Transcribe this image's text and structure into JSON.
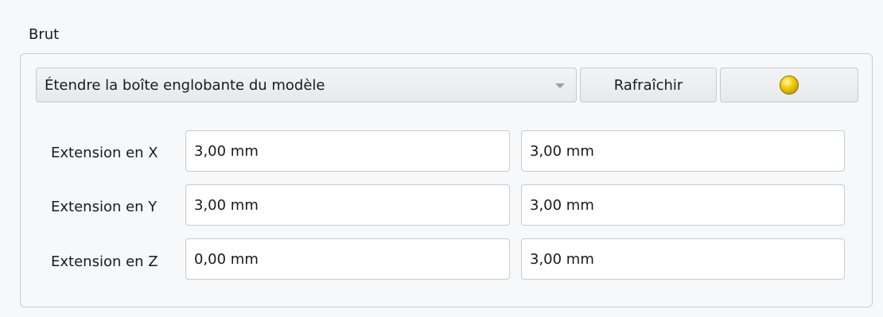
{
  "group": {
    "title": "Brut"
  },
  "toolbar": {
    "mode_selected": "Étendre la boîte englobante du modèle",
    "refresh_label": "Rafraîchir",
    "status_icon": "yellow-status-light-icon",
    "status_color": "#f4d20f"
  },
  "extensions": [
    {
      "label": "Extension en X",
      "min": "3,00 mm",
      "max": "3,00 mm"
    },
    {
      "label": "Extension en Y",
      "min": "3,00 mm",
      "max": "3,00 mm"
    },
    {
      "label": "Extension en Z",
      "min": "0,00 mm",
      "max": "3,00 mm"
    }
  ]
}
